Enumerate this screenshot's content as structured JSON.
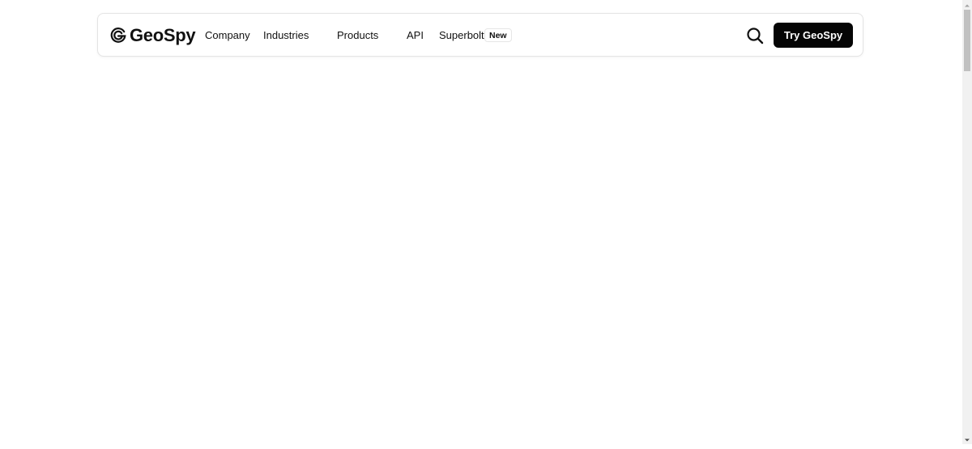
{
  "brand": {
    "name": "GeoSpy",
    "logo_icon": "geospy-logo-icon"
  },
  "nav": {
    "items": [
      {
        "label": "Company"
      },
      {
        "label": "Industries"
      },
      {
        "label": "Products"
      },
      {
        "label": "API"
      },
      {
        "label": "Superbolt"
      }
    ],
    "superbolt_badge": "New"
  },
  "actions": {
    "search_icon": "search-icon",
    "cta_label": "Try GeoSpy"
  },
  "colors": {
    "cta_background": "#050505",
    "cta_text": "#ffffff",
    "text": "#111111",
    "border": "#e4e4e4"
  }
}
